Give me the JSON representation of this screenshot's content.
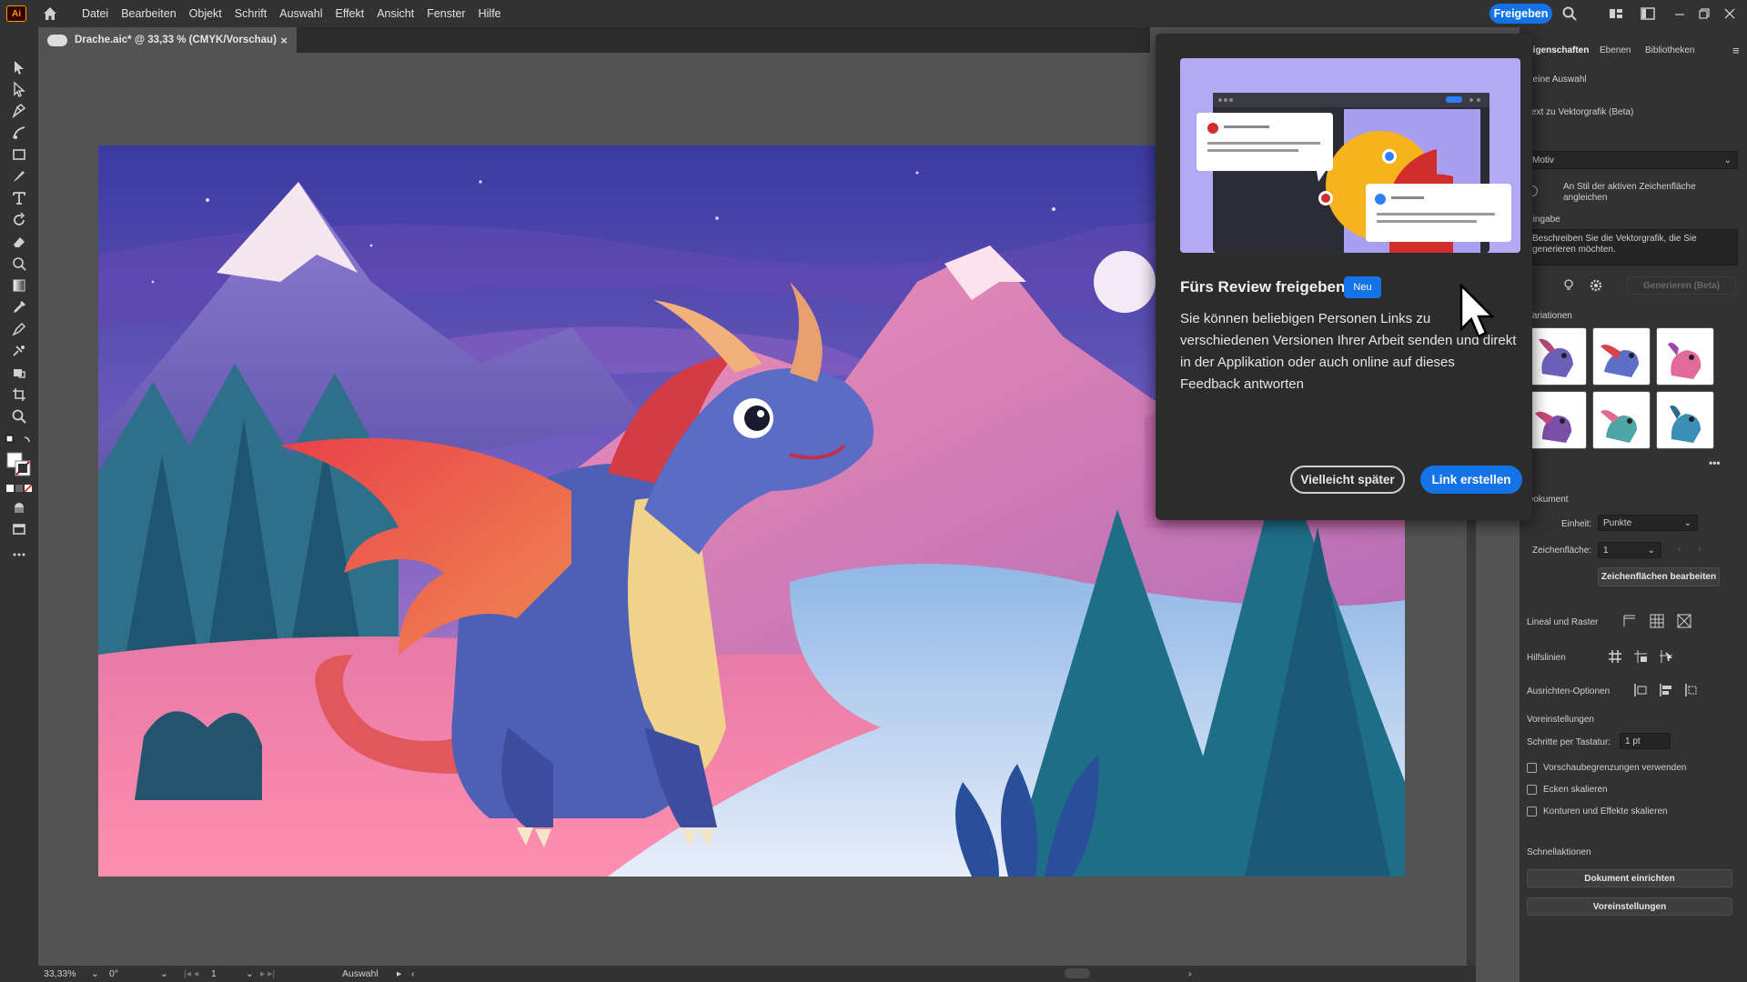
{
  "app": {
    "logo": "Ai"
  },
  "menubar": {
    "items": [
      "Datei",
      "Bearbeiten",
      "Objekt",
      "Schrift",
      "Auswahl",
      "Effekt",
      "Ansicht",
      "Fenster",
      "Hilfe"
    ],
    "share_label": "Freigeben"
  },
  "document_tab": {
    "title": "Drache.aic* @ 33,33 % (CMYK/Vorschau)",
    "close": "×"
  },
  "popup": {
    "title": "Fürs Review freigeben",
    "badge": "Neu",
    "body": "Sie können beliebigen Personen Links zu verschiedenen Versionen Ihrer Arbeit senden und direkt in der Applikation oder auch online auf dieses Feedback antworten",
    "later_label": "Vielleicht später",
    "create_label": "Link erstellen"
  },
  "right_panel": {
    "tabs": [
      "Eigenschaften",
      "Ebenen",
      "Bibliotheken"
    ],
    "selection_label": "Keine Auswahl",
    "text_to_vector_label": "Text zu Vektorgrafik (Beta)",
    "type_select": "Motiv",
    "match_style_label": "An Stil der aktiven Zeichenfläche angleichen",
    "prompt_section_label": "Eingabe",
    "prompt_placeholder": "Beschreiben Sie die Vektorgrafik, die Sie generieren möchten.",
    "generate_label": "Generieren (Beta)",
    "variations_label": "Variationen",
    "more_label": "•••",
    "document_label": "Dokument",
    "unit_label": "Einheit:",
    "unit_value": "Punkte",
    "artboard_label": "Zeichenfläche:",
    "artboard_value": "1",
    "edit_artboards_label": "Zeichenflächen bearbeiten",
    "ruler_grid_label": "Lineal und Raster",
    "guides_label": "Hilfslinien",
    "align_options_label": "Ausrichten-Optionen",
    "preferences_label": "Voreinstellungen",
    "keyboard_step_label": "Schritte per Tastatur:",
    "keyboard_step_value": "1 pt",
    "checkboxes": [
      "Vorschaubegrenzungen verwenden",
      "Ecken skalieren",
      "Konturen und Effekte skalieren"
    ],
    "quick_actions_label": "Schnellaktionen",
    "document_setup_label": "Dokument einrichten",
    "preferences_button_label": "Voreinstellungen"
  },
  "statusbar": {
    "zoom": "33,33%",
    "rotation": "0°",
    "artboard": "1",
    "tool": "Auswahl"
  }
}
